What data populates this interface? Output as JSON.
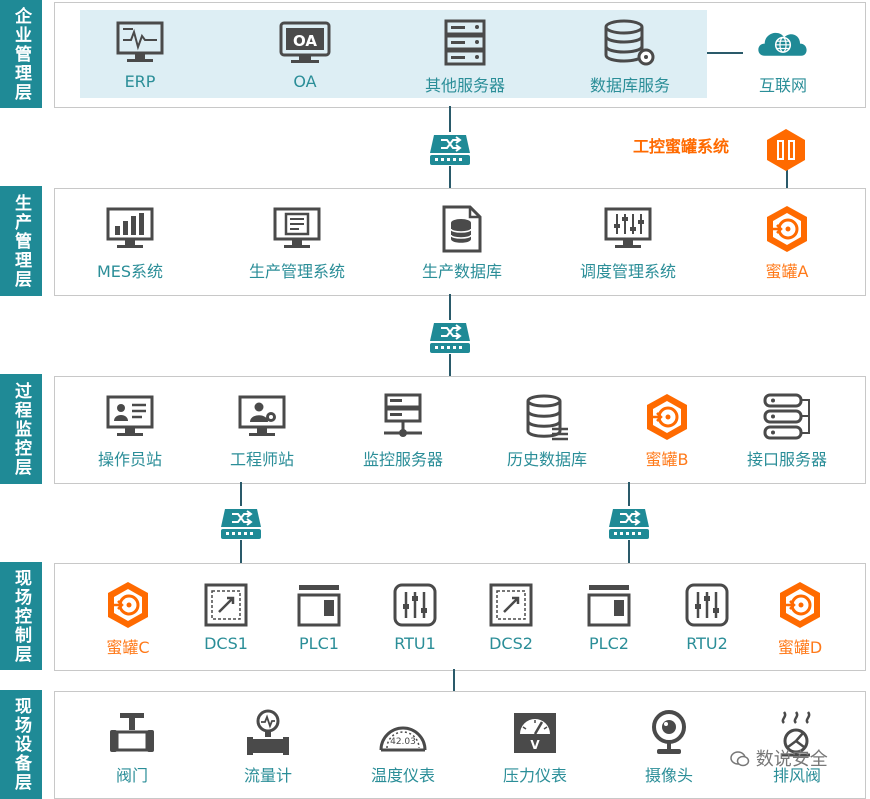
{
  "layers": [
    {
      "label": "企业管理层"
    },
    {
      "label": "生产管理层"
    },
    {
      "label": "过程监控层"
    },
    {
      "label": "现场控制层"
    },
    {
      "label": "现场设备层"
    }
  ],
  "enterprise": {
    "nodes": [
      {
        "label": "ERP",
        "icon": "erp-monitor-icon"
      },
      {
        "label": "OA",
        "icon": "oa-box-icon"
      },
      {
        "label": "其他服务器",
        "icon": "server-rack-icon"
      },
      {
        "label": "数据库服务",
        "icon": "database-gear-icon"
      }
    ],
    "internet": {
      "label": "互联网",
      "icon": "globe-cloud-icon"
    }
  },
  "honeypot_system": {
    "label": "工控蜜罐系统",
    "icon": "honeypot-box-icon"
  },
  "production": {
    "nodes": [
      {
        "label": "MES系统",
        "icon": "bar-chart-monitor-icon"
      },
      {
        "label": "生产管理系统",
        "icon": "document-monitor-icon"
      },
      {
        "label": "生产数据库",
        "icon": "database-document-icon"
      },
      {
        "label": "调度管理系统",
        "icon": "sliders-monitor-icon"
      },
      {
        "label": "蜜罐A",
        "icon": "honeypot-icon"
      }
    ]
  },
  "process": {
    "nodes": [
      {
        "label": "操作员站",
        "icon": "id-card-monitor-icon"
      },
      {
        "label": "工程师站",
        "icon": "engineer-monitor-icon"
      },
      {
        "label": "监控服务器",
        "icon": "network-server-icon"
      },
      {
        "label": "历史数据库",
        "icon": "history-database-icon"
      },
      {
        "label": "蜜罐B",
        "icon": "honeypot-icon"
      },
      {
        "label": "接口服务器",
        "icon": "interface-server-icon"
      }
    ]
  },
  "field_control": {
    "nodes": [
      {
        "label": "蜜罐C",
        "icon": "honeypot-icon"
      },
      {
        "label": "DCS1",
        "icon": "dcs-icon"
      },
      {
        "label": "PLC1",
        "icon": "plc-icon"
      },
      {
        "label": "RTU1",
        "icon": "rtu-icon"
      },
      {
        "label": "DCS2",
        "icon": "dcs-icon"
      },
      {
        "label": "PLC2",
        "icon": "plc-icon"
      },
      {
        "label": "RTU2",
        "icon": "rtu-icon"
      },
      {
        "label": "蜜罐D",
        "icon": "honeypot-icon"
      }
    ]
  },
  "field_devices": {
    "nodes": [
      {
        "label": "阀门",
        "icon": "valve-icon"
      },
      {
        "label": "流量计",
        "icon": "flowmeter-icon"
      },
      {
        "label": "温度仪表",
        "icon": "gauge-icon",
        "gauge_value": "42.03"
      },
      {
        "label": "压力仪表",
        "icon": "pressure-meter-icon",
        "meter_letter": "V"
      },
      {
        "label": "摄像头",
        "icon": "webcam-icon"
      },
      {
        "label": "排风阀",
        "icon": "exhaust-valve-icon"
      }
    ]
  },
  "watermark": {
    "text": "数说安全"
  },
  "colors": {
    "teal": "#1f8a96",
    "label_teal": "#2b8e98",
    "honeypot_orange": "#ff6a00",
    "panel_blue": "#ddeef4",
    "icon_dark": "#4a4a4a"
  }
}
